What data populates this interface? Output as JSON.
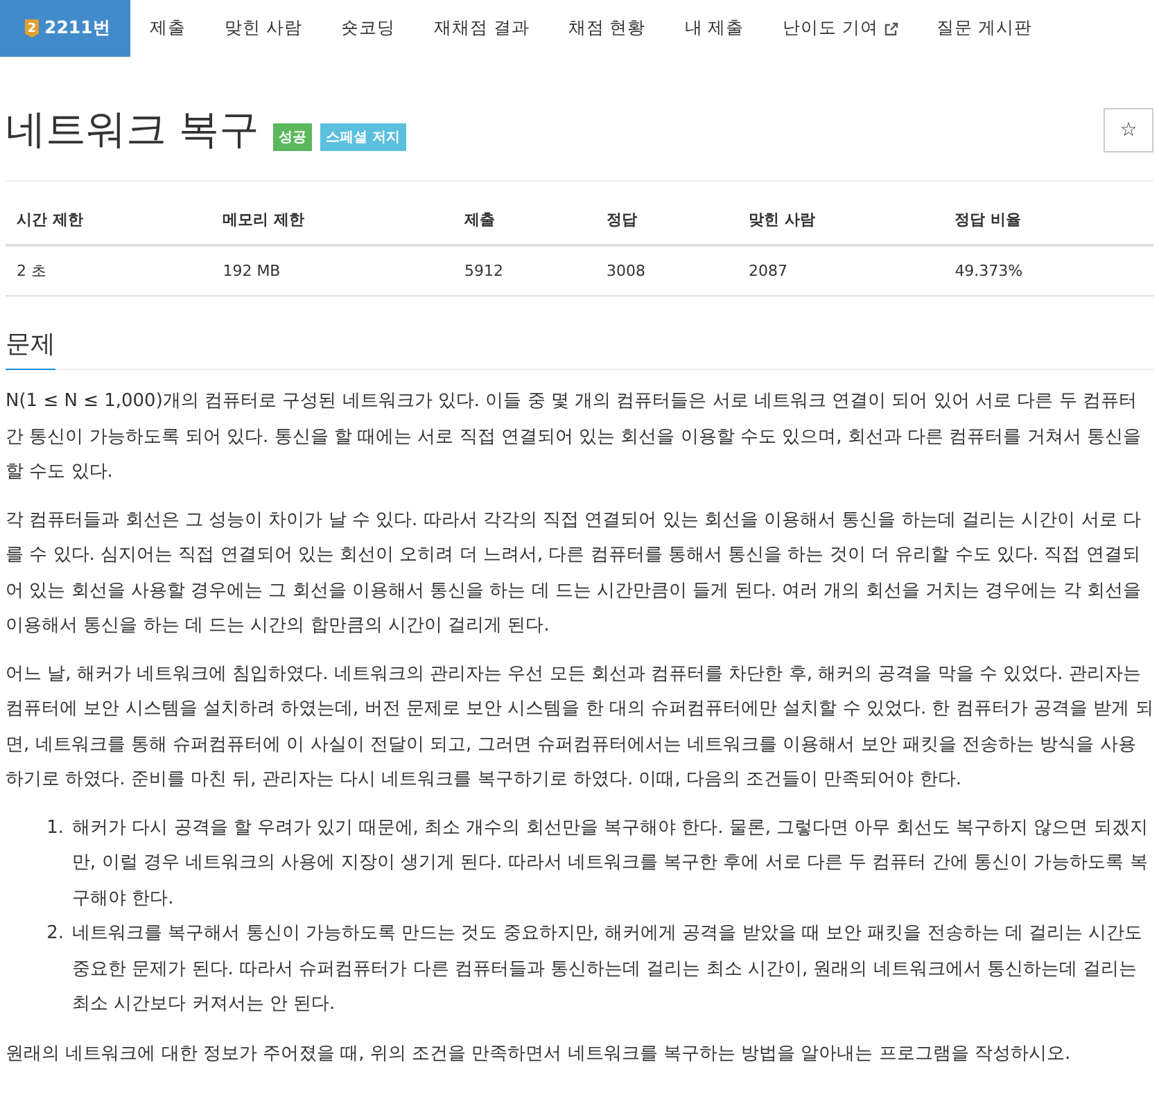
{
  "tabs": [
    {
      "label": "2211번",
      "tier": "2",
      "selected": true,
      "external": false
    },
    {
      "label": "제출",
      "selected": false,
      "external": false
    },
    {
      "label": "맞힌 사람",
      "selected": false,
      "external": false
    },
    {
      "label": "숏코딩",
      "selected": false,
      "external": false
    },
    {
      "label": "재채점 결과",
      "selected": false,
      "external": false
    },
    {
      "label": "채점 현황",
      "selected": false,
      "external": false
    },
    {
      "label": "내 제출",
      "selected": false,
      "external": false
    },
    {
      "label": "난이도 기여",
      "selected": false,
      "external": true
    },
    {
      "label": "질문 게시판",
      "selected": false,
      "external": false
    }
  ],
  "title": "네트워크 복구",
  "labels": [
    {
      "text": "성공",
      "color": "#5cb85c"
    },
    {
      "text": "스페셜 저지",
      "color": "#5bc0de"
    }
  ],
  "star_button": "☆",
  "table": {
    "columns": [
      "시간 제한",
      "메모리 제한",
      "제출",
      "정답",
      "맞힌 사람",
      "정답 비율"
    ],
    "rows": [
      [
        "2 초",
        "192 MB",
        "5912",
        "3008",
        "2087",
        "49.373%"
      ]
    ]
  },
  "section": {
    "heading": "문제",
    "blocks": [
      {
        "kind": "paragraph",
        "text": "N(1 ≤ N ≤ 1,000)개의 컴퓨터로 구성된 네트워크가 있다. 이들 중 몇 개의 컴퓨터들은 서로 네트워크 연결이 되어 있어 서로 다른 두 컴퓨터 간 통신이 가능하도록 되어 있다. 통신을 할 때에는 서로 직접 연결되어 있는 회선을 이용할 수도 있으며, 회선과 다른 컴퓨터를 거쳐서 통신을 할 수도 있다."
      },
      {
        "kind": "paragraph",
        "text": "각 컴퓨터들과 회선은 그 성능이 차이가 날 수 있다. 따라서 각각의 직접 연결되어 있는 회선을 이용해서 통신을 하는데 걸리는 시간이 서로 다를 수 있다. 심지어는 직접 연결되어 있는 회선이 오히려 더 느려서, 다른 컴퓨터를 통해서 통신을 하는 것이 더 유리할 수도 있다. 직접 연결되어 있는 회선을 사용할 경우에는 그 회선을 이용해서 통신을 하는 데 드는 시간만큼이 들게 된다. 여러 개의 회선을 거치는 경우에는 각 회선을 이용해서 통신을 하는 데 드는 시간의 합만큼의 시간이 걸리게 된다."
      },
      {
        "kind": "paragraph",
        "text": "어느 날, 해커가 네트워크에 침입하였다. 네트워크의 관리자는 우선 모든 회선과 컴퓨터를 차단한 후, 해커의 공격을 막을 수 있었다. 관리자는 컴퓨터에 보안 시스템을 설치하려 하였는데, 버전 문제로 보안 시스템을 한 대의 슈퍼컴퓨터에만 설치할 수 있었다. 한 컴퓨터가 공격을 받게 되면, 네트워크를 통해 슈퍼컴퓨터에 이 사실이 전달이 되고, 그러면 슈퍼컴퓨터에서는 네트워크를 이용해서 보안 패킷을 전송하는 방식을 사용하기로 하였다. 준비를 마친 뒤, 관리자는 다시 네트워크를 복구하기로 하였다. 이때, 다음의 조건들이 만족되어야 한다."
      },
      {
        "kind": "list",
        "items": [
          {
            "number": "1.",
            "text": "해커가 다시 공격을 할 우려가 있기 때문에, 최소 개수의 회선만을 복구해야 한다. 물론, 그렇다면 아무 회선도 복구하지 않으면 되겠지만, 이럴 경우 네트워크의 사용에 지장이 생기게 된다. 따라서 네트워크를 복구한 후에 서로 다른 두 컴퓨터 간에 통신이 가능하도록 복구해야 한다."
          },
          {
            "number": "2.",
            "text": "네트워크를 복구해서 통신이 가능하도록 만드는 것도 중요하지만, 해커에게 공격을 받았을 때 보안 패킷을 전송하는 데 걸리는 시간도 중요한 문제가 된다. 따라서 슈퍼컴퓨터가 다른 컴퓨터들과 통신하는데 걸리는 최소 시간이, 원래의 네트워크에서 통신하는데 걸리는 최소 시간보다 커져서는 안 된다."
          }
        ]
      },
      {
        "kind": "paragraph",
        "text": "원래의 네트워크에 대한 정보가 주어졌을 때, 위의 조건을 만족하면서 네트워크를 복구하는 방법을 알아내는 프로그램을 작성하시오."
      }
    ]
  }
}
